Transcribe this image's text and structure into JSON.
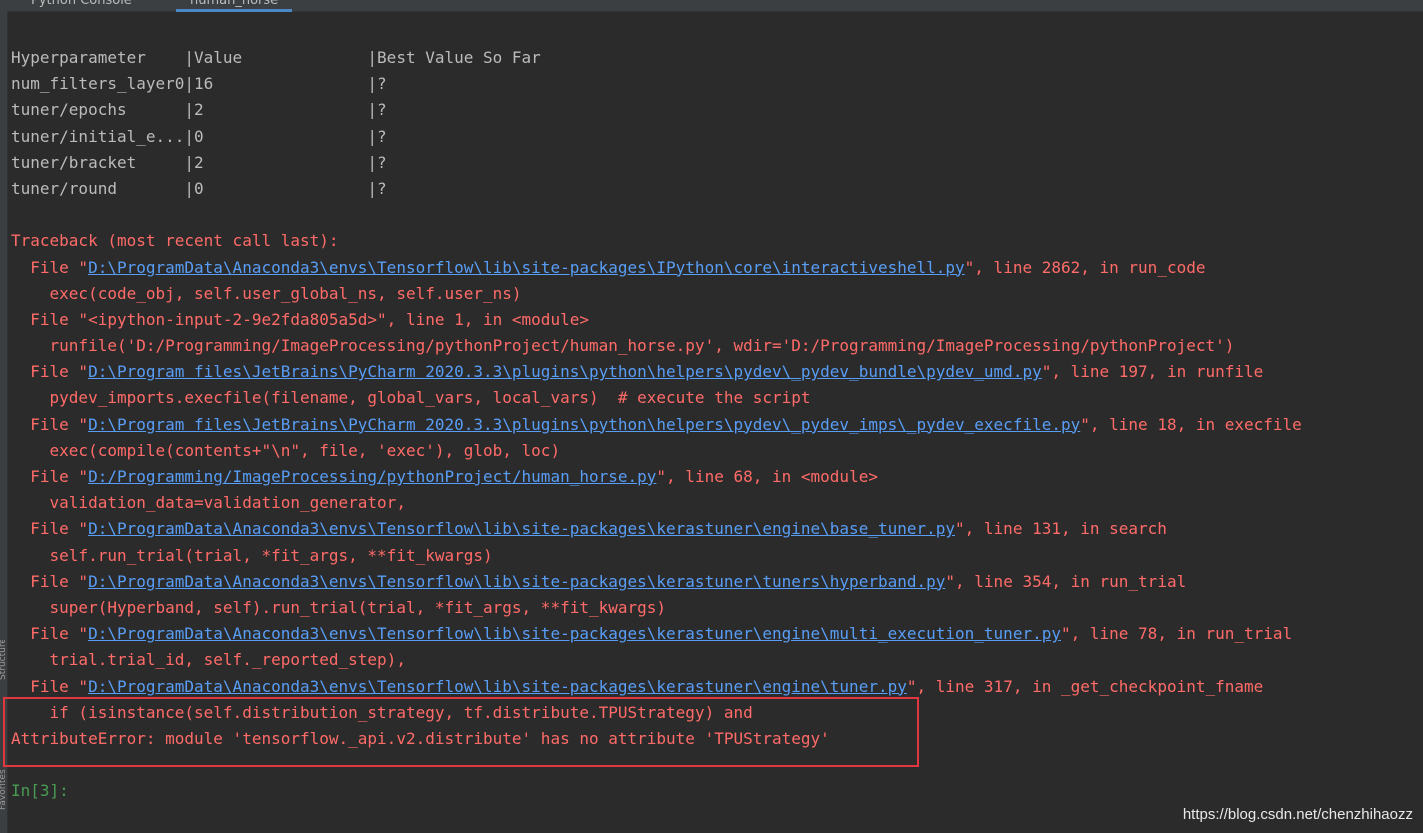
{
  "tabs": [
    {
      "label": "Python Console"
    },
    {
      "label": "human_horse"
    }
  ],
  "gutter": {
    "label_top": "Structure",
    "label_bottom": "Favorites"
  },
  "table": {
    "header": "Hyperparameter    |Value             |Best Value So Far",
    "rows": [
      "num_filters_layer0|16                |?",
      "tuner/epochs      |2                 |?",
      "tuner/initial_e...|0                 |?",
      "tuner/bracket     |2                 |?",
      "tuner/round       |0                 |?"
    ]
  },
  "traceback": {
    "header": "Traceback (most recent call last):",
    "frames": [
      {
        "prefix": "  File \"",
        "path": "D:\\ProgramData\\Anaconda3\\envs\\Tensorflow\\lib\\site-packages\\IPython\\core\\interactiveshell.py",
        "suffix": "\", line 2862, in run_code",
        "code": "    exec(code_obj, self.user_global_ns, self.user_ns)"
      },
      {
        "prefix": "  File \"",
        "path": "",
        "plain": "<ipython-input-2-9e2fda805a5d>",
        "suffix": "\", line 1, in <module>",
        "code": "    runfile('D:/Programming/ImageProcessing/pythonProject/human_horse.py', wdir='D:/Programming/ImageProcessing/pythonProject')"
      },
      {
        "prefix": "  File \"",
        "path": "D:\\Program files\\JetBrains\\PyCharm 2020.3.3\\plugins\\python\\helpers\\pydev\\_pydev_bundle\\pydev_umd.py",
        "suffix": "\", line 197, in runfile",
        "code": "    pydev_imports.execfile(filename, global_vars, local_vars)  # execute the script"
      },
      {
        "prefix": "  File \"",
        "path": "D:\\Program files\\JetBrains\\PyCharm 2020.3.3\\plugins\\python\\helpers\\pydev\\_pydev_imps\\_pydev_execfile.py",
        "suffix": "\", line 18, in execfile",
        "code": "    exec(compile(contents+\"\\n\", file, 'exec'), glob, loc)"
      },
      {
        "prefix": "  File \"",
        "path": "D:/Programming/ImageProcessing/pythonProject/human_horse.py",
        "suffix": "\", line 68, in <module>",
        "code": "    validation_data=validation_generator,"
      },
      {
        "prefix": "  File \"",
        "path": "D:\\ProgramData\\Anaconda3\\envs\\Tensorflow\\lib\\site-packages\\kerastuner\\engine\\base_tuner.py",
        "suffix": "\", line 131, in search",
        "code": "    self.run_trial(trial, *fit_args, **fit_kwargs)"
      },
      {
        "prefix": "  File \"",
        "path": "D:\\ProgramData\\Anaconda3\\envs\\Tensorflow\\lib\\site-packages\\kerastuner\\tuners\\hyperband.py",
        "suffix": "\", line 354, in run_trial",
        "code": "    super(Hyperband, self).run_trial(trial, *fit_args, **fit_kwargs)"
      },
      {
        "prefix": "  File \"",
        "path": "D:\\ProgramData\\Anaconda3\\envs\\Tensorflow\\lib\\site-packages\\kerastuner\\engine\\multi_execution_tuner.py",
        "suffix": "\", line 78, in run_trial",
        "code": "    trial.trial_id, self._reported_step),"
      },
      {
        "prefix": "  File \"",
        "path": "D:\\ProgramData\\Anaconda3\\envs\\Tensorflow\\lib\\site-packages\\kerastuner\\engine\\tuner.py",
        "suffix": "\", line 317, in _get_checkpoint_fname",
        "code": "    if (isinstance(self.distribution_strategy, tf.distribute.TPUStrategy) and"
      }
    ],
    "error": "AttributeError: module 'tensorflow._api.v2.distribute' has no attribute 'TPUStrategy'"
  },
  "prompt": "In[3]:",
  "watermark": "https://blog.csdn.net/chenzhihaozz",
  "colors": {
    "background": "#2b2b2b",
    "error": "#ff6b68",
    "link": "#589df6",
    "prompt": "#499c54",
    "highlight": "#e0373f"
  }
}
